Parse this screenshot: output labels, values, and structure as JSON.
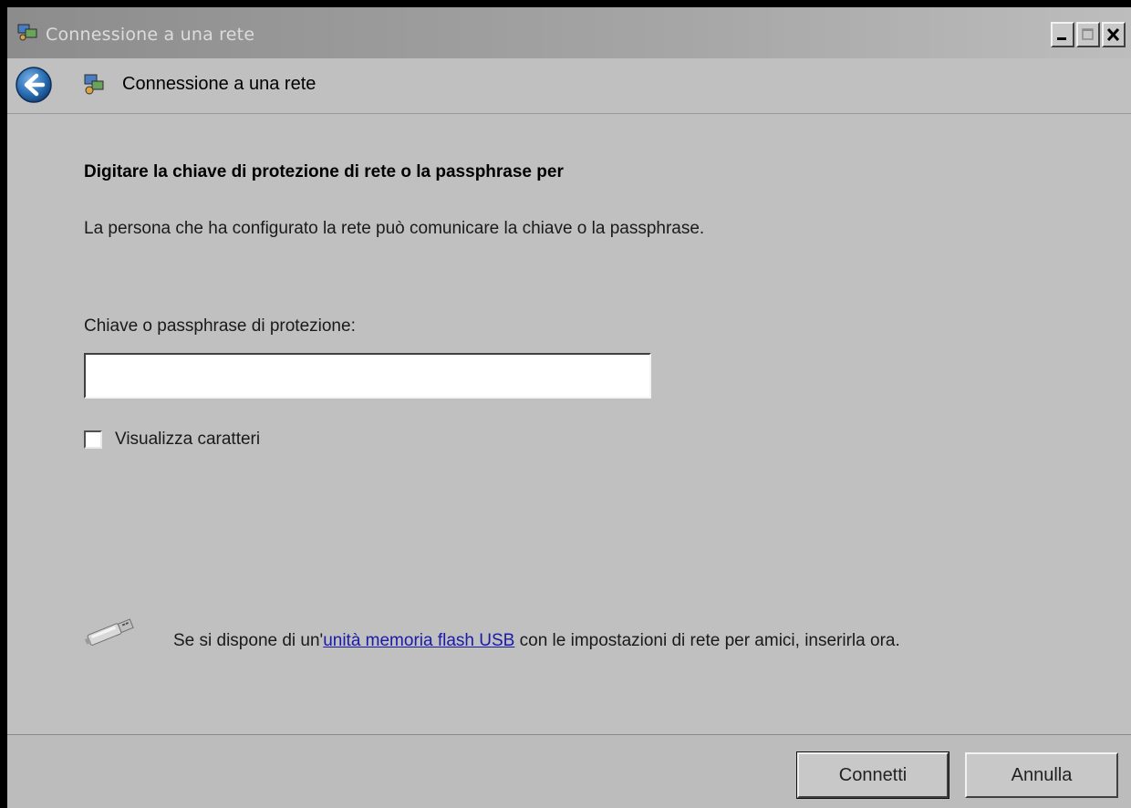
{
  "window": {
    "title": "Connessione a una rete"
  },
  "nav": {
    "title": "Connessione a una rete",
    "back_icon": "back-arrow-icon",
    "network_icon": "network-icon"
  },
  "content": {
    "heading": "Digitare la chiave di protezione di rete o la passphrase per",
    "description": "La persona che ha configurato la rete può comunicare la chiave o la passphrase.",
    "field_label": "Chiave o passphrase di protezione:",
    "key_value": "",
    "show_chars_label": "Visualizza caratteri",
    "show_chars_checked": false,
    "usb": {
      "icon": "usb-drive-icon",
      "text_before": "Se si dispone di un'",
      "link_text": "unità memoria flash USB",
      "text_after": " con le impostazioni di rete per amici, inserirla ora."
    }
  },
  "footer": {
    "connect_label": "Connetti",
    "cancel_label": "Annulla"
  },
  "colors": {
    "window_bg": "#c0c0c0",
    "link": "#1a1aa8",
    "back_button": "#2a6fb5"
  }
}
